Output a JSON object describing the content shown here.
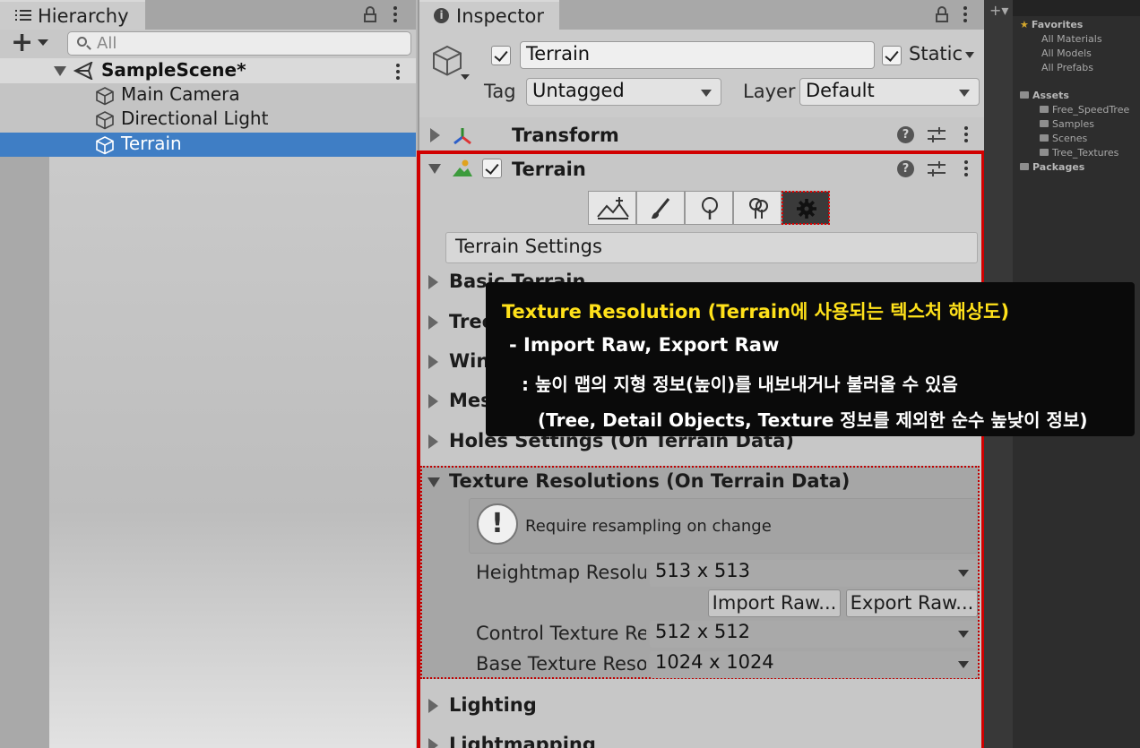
{
  "hierarchy": {
    "tab_title": "Hierarchy",
    "search_placeholder": "All",
    "scene": "SampleScene*",
    "items": [
      {
        "label": "Main Camera"
      },
      {
        "label": "Directional Light"
      },
      {
        "label": "Terrain",
        "selected": true
      }
    ]
  },
  "inspector": {
    "tab_title": "Inspector",
    "object_name": "Terrain",
    "static_label": "Static",
    "tag_label": "Tag",
    "tag_value": "Untagged",
    "layer_label": "Layer",
    "layer_value": "Default",
    "transform_label": "Transform",
    "terrain_label": "Terrain",
    "settings_title": "Terrain Settings",
    "sections": {
      "basic": "Basic Terrain",
      "tree": "Tree",
      "wind": "Wind",
      "mesh": "Mesh",
      "holes": "Holes Settings (On Terrain Data)",
      "texture_res": "Texture Resolutions (On Terrain Data)",
      "lighting": "Lighting",
      "lightmapping": "Lightmapping"
    },
    "warning": "Require resampling on change",
    "heightmap_label": "Heightmap Resolution",
    "heightmap_value": "513 x 513",
    "import_raw": "Import Raw...",
    "export_raw": "Export Raw...",
    "control_label": "Control Texture Resolution",
    "control_value": "512 x 512",
    "base_label": "Base Texture Resolution",
    "base_value": "1024 x 1024"
  },
  "tools": [
    {
      "icon": "raise-terrain-icon"
    },
    {
      "icon": "paint-brush-icon"
    },
    {
      "icon": "paint-trees-icon"
    },
    {
      "icon": "paint-details-icon"
    },
    {
      "icon": "terrain-settings-gear-icon",
      "active": true
    }
  ],
  "project": {
    "favorites": "Favorites",
    "fav_items": [
      "All Materials",
      "All Models",
      "All Prefabs"
    ],
    "assets": "Assets",
    "asset_items": [
      "Free_SpeedTree",
      "Samples",
      "Scenes",
      "Tree_Textures"
    ],
    "packages": "Packages"
  },
  "tooltip": {
    "title": "Texture Resolution (Terrain에 사용되는 텍스처 해상도)",
    "line1": "- Import Raw, Export Raw",
    "line2": ": 높이 맵의 지형 정보(높이)를 내보내거나 불러올 수 있음",
    "line3": "(Tree, Detail Objects, Texture 정보를 제외한 순수 높낮이 정보)"
  },
  "colors": {
    "selection": "#3f7ec5",
    "highlight_border": "#d10000",
    "tooltip_title": "#ffe11a"
  }
}
